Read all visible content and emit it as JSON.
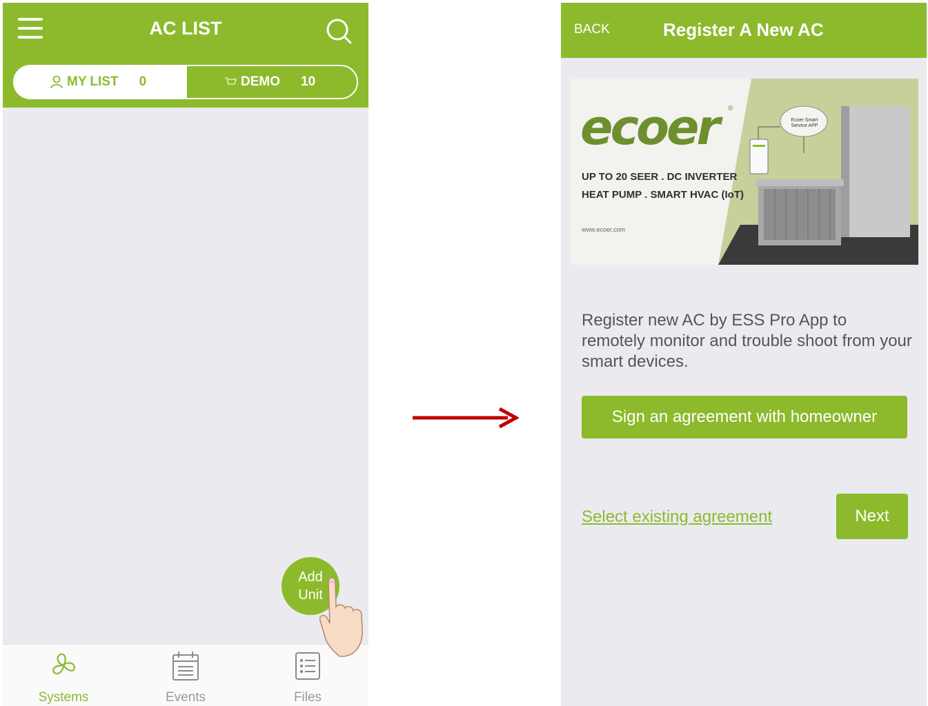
{
  "left_screen": {
    "title": "AC LIST",
    "tabs": {
      "my_list": {
        "label": "MY LIST",
        "count": "0"
      },
      "demo": {
        "label": "DEMO",
        "count": "10"
      }
    },
    "fab": {
      "line1": "Add",
      "line2": "Unit"
    },
    "bottom_nav": [
      {
        "label": "Systems",
        "icon": "fan-icon"
      },
      {
        "label": "Events",
        "icon": "calendar-icon"
      },
      {
        "label": "Files",
        "icon": "file-list-icon"
      }
    ],
    "colors": {
      "accent": "#8cba2c",
      "background": "#ebebef"
    }
  },
  "right_screen": {
    "back": "BACK",
    "title": "Register A New AC",
    "banner": {
      "brand": "ecoer",
      "reg_mark": "®",
      "tagline_line1": "UP TO 20 SEER . DC INVERTER",
      "tagline_line2": "HEAT PUMP . SMART HVAC (IoT)",
      "url": "www.ecoer.com",
      "cloud_label": "Ecoer Smart Service APP"
    },
    "description": "Register new AC by ESS Pro App to remotely monitor and trouble shoot from your smart devices.",
    "sign_button": "Sign an agreement with homeowner",
    "select_link": "Select existing agreement",
    "next_button": "Next"
  },
  "flow_arrow": {
    "icon": "right-arrow-icon",
    "color": "#c00000"
  }
}
